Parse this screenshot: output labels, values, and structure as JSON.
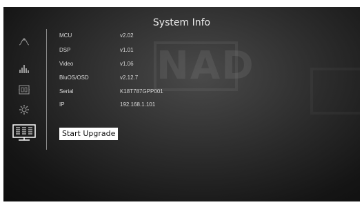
{
  "header": {
    "title": "System Info"
  },
  "sidebar": {
    "items": [
      {
        "icon": "tone-wave-icon"
      },
      {
        "icon": "equalizer-icon"
      },
      {
        "icon": "speaker-setup-icon"
      },
      {
        "icon": "gear-icon"
      },
      {
        "icon": "system-info-icon",
        "selected": true
      }
    ]
  },
  "watermark": {
    "text": "NAD"
  },
  "info": [
    {
      "label": "MCU",
      "value": "v2.02"
    },
    {
      "label": "DSP",
      "value": "v1.01"
    },
    {
      "label": "Video",
      "value": "v1.06"
    },
    {
      "label": "BluOS/OSD",
      "value": "v2.12.7"
    },
    {
      "label": "Serial",
      "value": "K18T787GPP001"
    },
    {
      "label": "IP",
      "value": "192.168.1.101"
    }
  ],
  "actions": {
    "upgrade_label": "Start Upgrade"
  },
  "colors": {
    "background": "#1e1e1e",
    "text": "#d8d8d8",
    "highlight": "#ffffff"
  }
}
